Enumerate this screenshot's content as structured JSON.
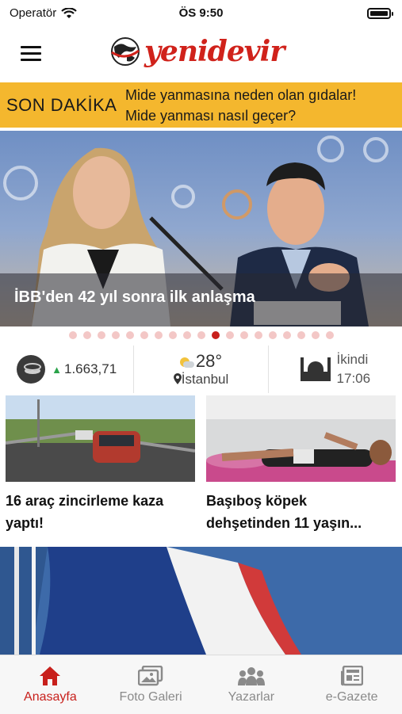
{
  "status_bar": {
    "carrier": "Operatör",
    "time": "ÖS 9:50"
  },
  "header": {
    "logo_text": "yenidevir"
  },
  "breaking": {
    "label": "SON DAKİKA",
    "line1": "Mide yanmasına neden olan gıdalar!",
    "line2": "Mide yanması nasıl geçer?"
  },
  "hero": {
    "caption": "İBB'den 42 yıl sonra ilk anlaşma",
    "slide_count": 19,
    "active_slide": 10
  },
  "info": {
    "price": "1.663,71",
    "price_trend": "up",
    "temperature": "28°",
    "city": "İstanbul",
    "prayer_name": "İkindi",
    "prayer_time": "17:06"
  },
  "articles": [
    {
      "title_line1": "16 araç zincirleme kaza",
      "title_line2": "yaptı!"
    },
    {
      "title_line1": "Başıboş köpek",
      "title_line2": "dehşetinden 11 yaşın..."
    }
  ],
  "tabs": [
    {
      "label": "Anasayfa",
      "icon": "home-icon",
      "active": true
    },
    {
      "label": "Foto Galeri",
      "icon": "photo-gallery-icon",
      "active": false
    },
    {
      "label": "Yazarlar",
      "icon": "authors-icon",
      "active": false
    },
    {
      "label": "e-Gazete",
      "icon": "newspaper-icon",
      "active": false
    }
  ],
  "colors": {
    "brand_red": "#c8201c",
    "breaking_bg": "#f4b72e",
    "trend_up": "#2aa34a"
  }
}
